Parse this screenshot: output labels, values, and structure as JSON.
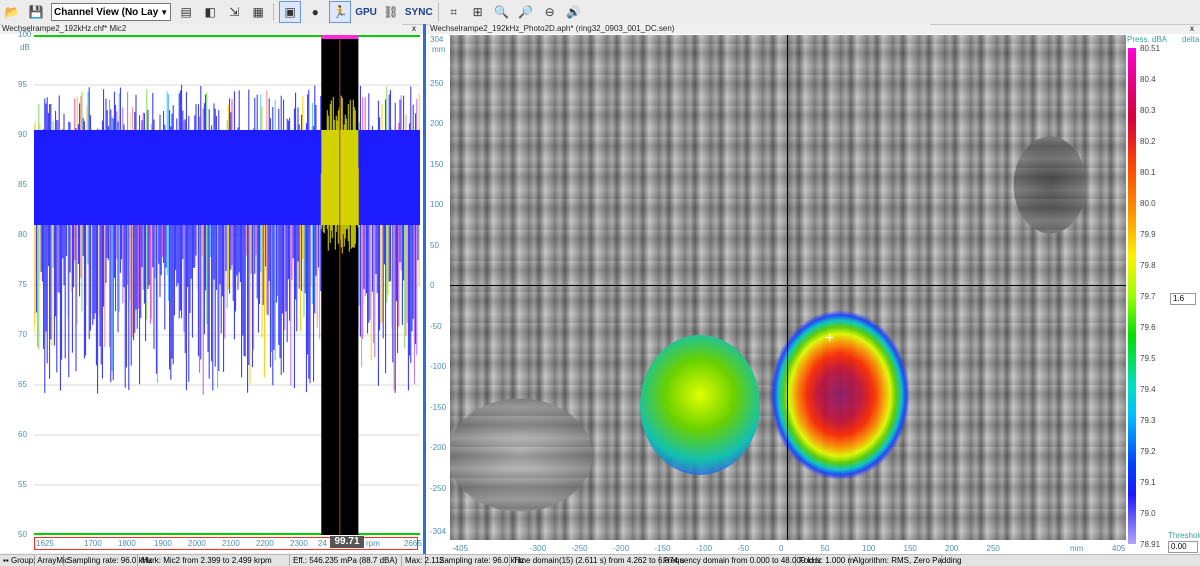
{
  "toolbar": {
    "channel_view_label": "Channel View (No Lay",
    "gpu_label": "GPU",
    "sync_label": "SYNC",
    "icons": [
      "folder-open-icon",
      "save-icon",
      "overview-icon",
      "camera-icon",
      "export-icon",
      "presentation-icon",
      "rec-icon",
      "run-icon",
      "gpu",
      "network-icon",
      "sync",
      "select-icon",
      "add-icon",
      "zoom-in-icon",
      "zoom-out-icon",
      "zoom-reset-icon",
      "sound-icon"
    ]
  },
  "left_panel": {
    "title": "Wechselrampe2_192kHz.chf* Mic2",
    "close": "x",
    "yunit": "dB",
    "yticks": [
      "100",
      "95",
      "90",
      "85",
      "80",
      "75",
      "70",
      "65",
      "60",
      "55",
      "50"
    ],
    "xticks": [
      "1625",
      "1700",
      "1800",
      "1900",
      "2000",
      "2100",
      "2200",
      "2300",
      "24",
      "rpm",
      "2665"
    ],
    "marker_value": "99.71"
  },
  "right_panel": {
    "title": "Wechselrampe2_192kHz_Photo2D.aph* (ring32_0903_001_DC.sen)",
    "close": "x",
    "yunit": "mm",
    "yticks": [
      "304",
      "250",
      "200",
      "150",
      "100",
      "50",
      "0",
      "-50",
      "-100",
      "-150",
      "-200",
      "-250",
      "-304"
    ],
    "xticks": [
      "-405",
      "-300",
      "-250",
      "-200",
      "-150",
      "-100",
      "-50",
      "0",
      "50",
      "100",
      "150",
      "200",
      "250",
      "mm",
      "405"
    ],
    "colorbar_title": "Press. dBA",
    "colorbar_delta": "delta",
    "colorbar_ticks": [
      "80.51",
      "80.4",
      "80.3",
      "80.2",
      "80.1",
      "80.0",
      "79.9",
      "79.8",
      "79.7",
      "79.6",
      "79.5",
      "79.4",
      "79.3",
      "79.2",
      "79.1",
      "79.0",
      "78.91"
    ],
    "delta_value": "1.6",
    "threshold_label": "Threshold",
    "threshold_value": "0.00"
  },
  "status": {
    "left": [
      "Group: ArrayMic",
      "Sampling rate: 96.0 kHz",
      "Mark: Mic2 from 2.399 to 2.499 krpm",
      "Eff.: 546.235 mPa (88.7 dBA)",
      "Max: 2.112"
    ],
    "right": [
      "Sampling rate: 96.0 kHz",
      "Time domain(15) (2.611 s) from 4.262 to 6.874 s",
      "Frequency domain from 0.000 to 48.000 kHz",
      "Focus: 1.000 m",
      "Algorithm: RMS, Zero Padding"
    ]
  },
  "chart_data": [
    {
      "type": "area",
      "title": "",
      "xlabel": "rpm",
      "ylabel": "dB",
      "xlim": [
        1625,
        2665
      ],
      "ylim": [
        50,
        100
      ],
      "series": [
        {
          "name": "",
          "values": [
            88,
            87,
            88,
            87,
            87,
            88,
            86,
            88,
            88,
            87,
            87,
            88,
            86,
            87,
            88,
            87,
            87,
            86,
            88,
            87
          ]
        }
      ],
      "marker": {
        "from": 2399,
        "to": 2499,
        "value": 99.71
      }
    }
  ]
}
